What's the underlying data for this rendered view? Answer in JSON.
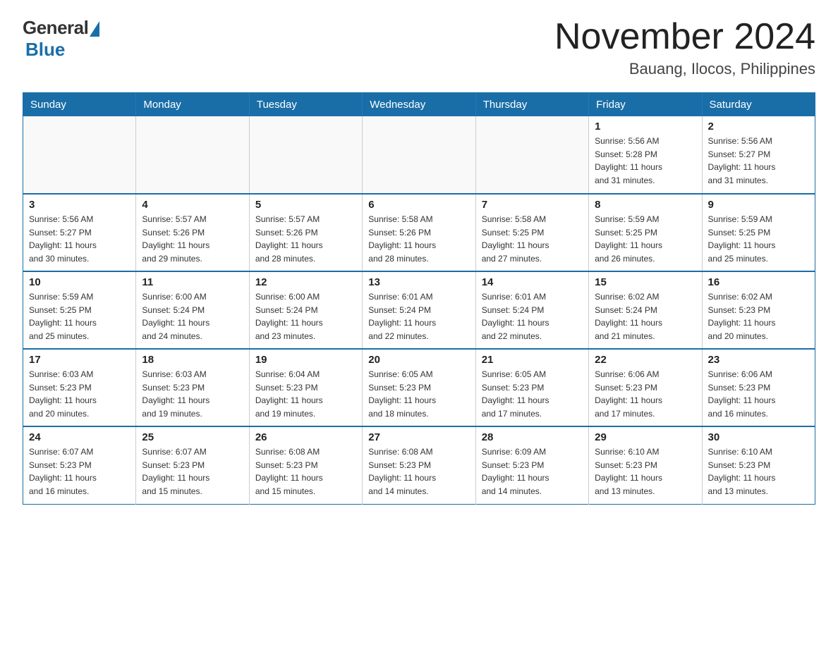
{
  "logo": {
    "general": "General",
    "blue": "Blue"
  },
  "header": {
    "title": "November 2024",
    "subtitle": "Bauang, Ilocos, Philippines"
  },
  "weekdays": [
    "Sunday",
    "Monday",
    "Tuesday",
    "Wednesday",
    "Thursday",
    "Friday",
    "Saturday"
  ],
  "weeks": [
    [
      {
        "day": "",
        "info": ""
      },
      {
        "day": "",
        "info": ""
      },
      {
        "day": "",
        "info": ""
      },
      {
        "day": "",
        "info": ""
      },
      {
        "day": "",
        "info": ""
      },
      {
        "day": "1",
        "info": "Sunrise: 5:56 AM\nSunset: 5:28 PM\nDaylight: 11 hours\nand 31 minutes."
      },
      {
        "day": "2",
        "info": "Sunrise: 5:56 AM\nSunset: 5:27 PM\nDaylight: 11 hours\nand 31 minutes."
      }
    ],
    [
      {
        "day": "3",
        "info": "Sunrise: 5:56 AM\nSunset: 5:27 PM\nDaylight: 11 hours\nand 30 minutes."
      },
      {
        "day": "4",
        "info": "Sunrise: 5:57 AM\nSunset: 5:26 PM\nDaylight: 11 hours\nand 29 minutes."
      },
      {
        "day": "5",
        "info": "Sunrise: 5:57 AM\nSunset: 5:26 PM\nDaylight: 11 hours\nand 28 minutes."
      },
      {
        "day": "6",
        "info": "Sunrise: 5:58 AM\nSunset: 5:26 PM\nDaylight: 11 hours\nand 28 minutes."
      },
      {
        "day": "7",
        "info": "Sunrise: 5:58 AM\nSunset: 5:25 PM\nDaylight: 11 hours\nand 27 minutes."
      },
      {
        "day": "8",
        "info": "Sunrise: 5:59 AM\nSunset: 5:25 PM\nDaylight: 11 hours\nand 26 minutes."
      },
      {
        "day": "9",
        "info": "Sunrise: 5:59 AM\nSunset: 5:25 PM\nDaylight: 11 hours\nand 25 minutes."
      }
    ],
    [
      {
        "day": "10",
        "info": "Sunrise: 5:59 AM\nSunset: 5:25 PM\nDaylight: 11 hours\nand 25 minutes."
      },
      {
        "day": "11",
        "info": "Sunrise: 6:00 AM\nSunset: 5:24 PM\nDaylight: 11 hours\nand 24 minutes."
      },
      {
        "day": "12",
        "info": "Sunrise: 6:00 AM\nSunset: 5:24 PM\nDaylight: 11 hours\nand 23 minutes."
      },
      {
        "day": "13",
        "info": "Sunrise: 6:01 AM\nSunset: 5:24 PM\nDaylight: 11 hours\nand 22 minutes."
      },
      {
        "day": "14",
        "info": "Sunrise: 6:01 AM\nSunset: 5:24 PM\nDaylight: 11 hours\nand 22 minutes."
      },
      {
        "day": "15",
        "info": "Sunrise: 6:02 AM\nSunset: 5:24 PM\nDaylight: 11 hours\nand 21 minutes."
      },
      {
        "day": "16",
        "info": "Sunrise: 6:02 AM\nSunset: 5:23 PM\nDaylight: 11 hours\nand 20 minutes."
      }
    ],
    [
      {
        "day": "17",
        "info": "Sunrise: 6:03 AM\nSunset: 5:23 PM\nDaylight: 11 hours\nand 20 minutes."
      },
      {
        "day": "18",
        "info": "Sunrise: 6:03 AM\nSunset: 5:23 PM\nDaylight: 11 hours\nand 19 minutes."
      },
      {
        "day": "19",
        "info": "Sunrise: 6:04 AM\nSunset: 5:23 PM\nDaylight: 11 hours\nand 19 minutes."
      },
      {
        "day": "20",
        "info": "Sunrise: 6:05 AM\nSunset: 5:23 PM\nDaylight: 11 hours\nand 18 minutes."
      },
      {
        "day": "21",
        "info": "Sunrise: 6:05 AM\nSunset: 5:23 PM\nDaylight: 11 hours\nand 17 minutes."
      },
      {
        "day": "22",
        "info": "Sunrise: 6:06 AM\nSunset: 5:23 PM\nDaylight: 11 hours\nand 17 minutes."
      },
      {
        "day": "23",
        "info": "Sunrise: 6:06 AM\nSunset: 5:23 PM\nDaylight: 11 hours\nand 16 minutes."
      }
    ],
    [
      {
        "day": "24",
        "info": "Sunrise: 6:07 AM\nSunset: 5:23 PM\nDaylight: 11 hours\nand 16 minutes."
      },
      {
        "day": "25",
        "info": "Sunrise: 6:07 AM\nSunset: 5:23 PM\nDaylight: 11 hours\nand 15 minutes."
      },
      {
        "day": "26",
        "info": "Sunrise: 6:08 AM\nSunset: 5:23 PM\nDaylight: 11 hours\nand 15 minutes."
      },
      {
        "day": "27",
        "info": "Sunrise: 6:08 AM\nSunset: 5:23 PM\nDaylight: 11 hours\nand 14 minutes."
      },
      {
        "day": "28",
        "info": "Sunrise: 6:09 AM\nSunset: 5:23 PM\nDaylight: 11 hours\nand 14 minutes."
      },
      {
        "day": "29",
        "info": "Sunrise: 6:10 AM\nSunset: 5:23 PM\nDaylight: 11 hours\nand 13 minutes."
      },
      {
        "day": "30",
        "info": "Sunrise: 6:10 AM\nSunset: 5:23 PM\nDaylight: 11 hours\nand 13 minutes."
      }
    ]
  ]
}
